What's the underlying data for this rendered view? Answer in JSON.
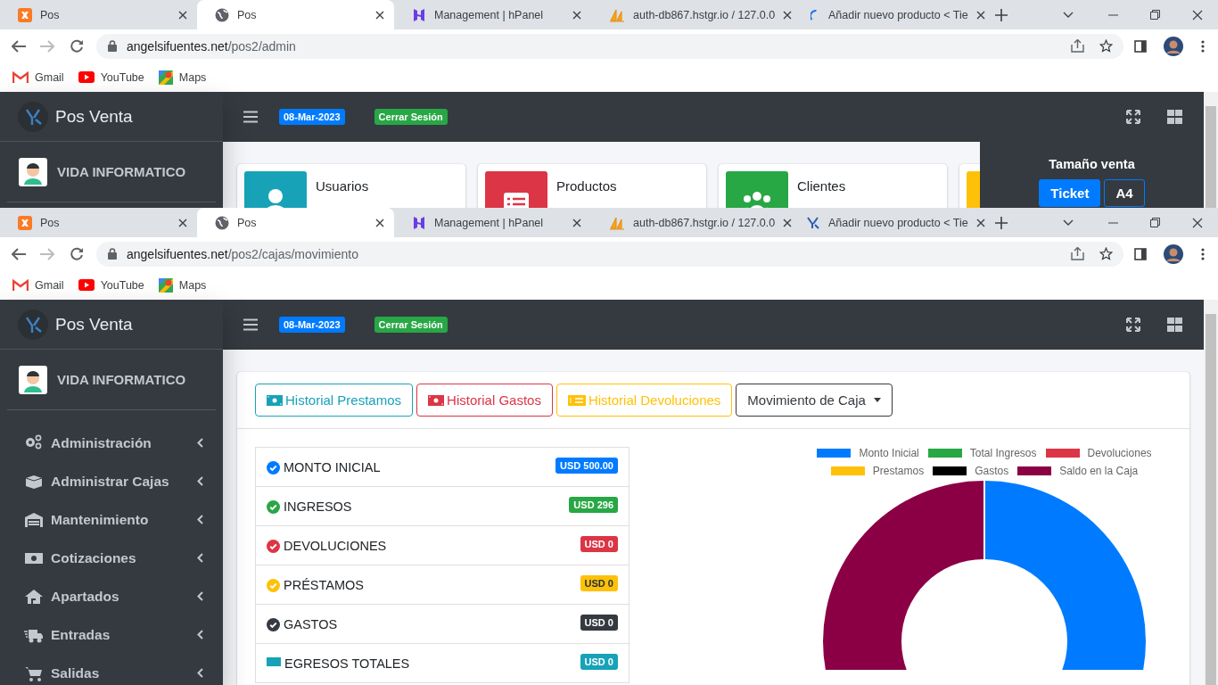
{
  "windows": [
    {
      "tabs": [
        {
          "label": "Pos",
          "kind": "xampp",
          "selected": false
        },
        {
          "label": "Pos",
          "kind": "globe",
          "selected": true
        },
        {
          "label": "Management | hPanel",
          "kind": "hpanel",
          "selected": false
        },
        {
          "label": "auth-db867.hstgr.io / 127.0.0",
          "kind": "pma",
          "selected": false
        },
        {
          "label": "Añadir nuevo producto < Tie",
          "kind": "spinner",
          "selected": false
        }
      ],
      "url": "angelsifuentes.net/pos2/admin",
      "bookmarks": [
        {
          "label": "Gmail",
          "kind": "gmail"
        },
        {
          "label": "YouTube",
          "kind": "youtube"
        },
        {
          "label": "Maps",
          "kind": "maps"
        }
      ],
      "app": {
        "brand": "Pos Venta",
        "user": "VIDA INFORMATICO",
        "date": "08-Mar-2023",
        "logout": "Cerrar Sesión",
        "cards": [
          {
            "label": "Usuarios",
            "kind": "user",
            "color": "#17a2b8"
          },
          {
            "label": "Productos",
            "kind": "list",
            "color": "#dc3545"
          },
          {
            "label": "Clientes",
            "kind": "people",
            "color": "#28a745"
          },
          {
            "kind": "tile",
            "color": "#ffc107"
          }
        ],
        "size_panel": {
          "title": "Tamaño venta",
          "options": [
            {
              "label": "Ticket",
              "selected": true
            },
            {
              "label": "A4",
              "selected": false
            }
          ]
        }
      }
    },
    {
      "tabs": [
        {
          "label": "Pos",
          "kind": "xampp",
          "selected": false
        },
        {
          "label": "Pos",
          "kind": "globe",
          "selected": true
        },
        {
          "label": "Management | hPanel",
          "kind": "hpanel",
          "selected": false
        },
        {
          "label": "auth-db867.hstgr.io / 127.0.0",
          "kind": "pma",
          "selected": false
        },
        {
          "label": "Añadir nuevo producto < Tie",
          "kind": "logo",
          "selected": false
        }
      ],
      "url": "angelsifuentes.net/pos2/cajas/movimiento",
      "bookmarks": [
        {
          "label": "Gmail",
          "kind": "gmail"
        },
        {
          "label": "YouTube",
          "kind": "youtube"
        },
        {
          "label": "Maps",
          "kind": "maps"
        }
      ],
      "app": {
        "brand": "Pos Venta",
        "user": "VIDA INFORMATICO",
        "date": "08-Mar-2023",
        "logout": "Cerrar Sesión",
        "menu": [
          {
            "label": "Administración",
            "kind": "gears"
          },
          {
            "label": "Administrar Cajas",
            "kind": "box"
          },
          {
            "label": "Mantenimiento",
            "kind": "warehouse"
          },
          {
            "label": "Cotizaciones",
            "kind": "money"
          },
          {
            "label": "Apartados",
            "kind": "house"
          },
          {
            "label": "Entradas",
            "kind": "truck"
          },
          {
            "label": "Salidas",
            "kind": "cart"
          }
        ],
        "actions": [
          {
            "label": "Historial Prestamos",
            "kind": "money",
            "color": "#17a2b8"
          },
          {
            "label": "Historial Gastos",
            "kind": "money",
            "color": "#dc3545"
          },
          {
            "label": "Historial Devoluciones",
            "kind": "bill",
            "color": "#ffc107"
          },
          {
            "label": "Movimiento de Caja",
            "kind": "dropdown",
            "color": "#343a40"
          }
        ],
        "summary": [
          {
            "label": "MONTO INICIAL",
            "amount": "USD 500.00",
            "color": "#007bff",
            "kind": "check"
          },
          {
            "label": "INGRESOS",
            "amount": "USD 296",
            "color": "#28a745",
            "kind": "check"
          },
          {
            "label": "DEVOLUCIONES",
            "amount": "USD 0",
            "color": "#dc3545",
            "kind": "check"
          },
          {
            "label": "PRÉSTAMOS",
            "amount": "USD 0",
            "color": "#ffc107",
            "kind": "check"
          },
          {
            "label": "GASTOS",
            "amount": "USD 0",
            "color": "#343a40",
            "kind": "check"
          },
          {
            "label": "EGRESOS TOTALES",
            "amount": "USD 0",
            "color": "#17a2b8",
            "kind": "square"
          }
        ],
        "legend": [
          {
            "label": "Monto Inicial",
            "color": "#007bff"
          },
          {
            "label": "Total Ingresos",
            "color": "#28a745"
          },
          {
            "label": "Devoluciones",
            "color": "#dc3545"
          },
          {
            "label": "Prestamos",
            "color": "#ffc107"
          },
          {
            "label": "Gastos",
            "color": "#000000"
          },
          {
            "label": "Saldo en la Caja",
            "color": "#8b0045"
          }
        ]
      }
    }
  ]
}
